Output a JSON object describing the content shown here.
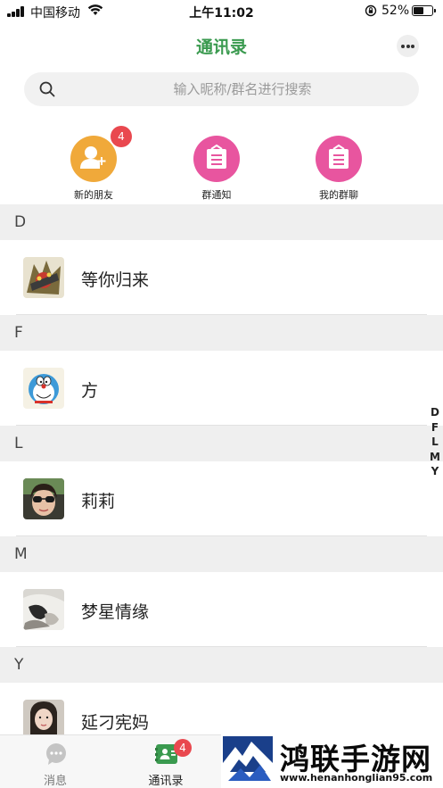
{
  "status_bar": {
    "carrier": "中国移动",
    "time": "上午11:02",
    "battery_percent": "52%",
    "battery_level": 0.52
  },
  "header": {
    "title": "通讯录",
    "more_icon": "more-dots-icon"
  },
  "search": {
    "placeholder": "输入昵称/群名进行搜索",
    "icon": "search-icon"
  },
  "quick_actions": [
    {
      "label": "新的朋友",
      "icon": "add-friend-icon",
      "color": "#f0a93a",
      "badge": "4"
    },
    {
      "label": "群通知",
      "icon": "notice-board-icon",
      "color": "#e8559f"
    },
    {
      "label": "我的群聊",
      "icon": "notice-board-icon",
      "color": "#e8559f"
    }
  ],
  "sections": [
    {
      "letter": "D",
      "contacts": [
        {
          "name": "等你归来"
        }
      ]
    },
    {
      "letter": "F",
      "contacts": [
        {
          "name": "方"
        }
      ]
    },
    {
      "letter": "L",
      "contacts": [
        {
          "name": "莉莉"
        }
      ]
    },
    {
      "letter": "M",
      "contacts": [
        {
          "name": "梦星情缘"
        }
      ]
    },
    {
      "letter": "Y",
      "contacts": [
        {
          "name": "延刁宪妈"
        }
      ]
    }
  ],
  "index_bar": [
    "D",
    "F",
    "L",
    "M",
    "Y"
  ],
  "tab_bar": {
    "tabs": [
      {
        "label": "消息",
        "icon": "chat-bubble-icon",
        "active": false
      },
      {
        "label": "通讯录",
        "icon": "contacts-book-icon",
        "active": true,
        "badge": "4"
      }
    ]
  },
  "watermark": {
    "title": "鸿联手游网",
    "url": "www.henanhonglian95.com"
  },
  "colors": {
    "accent_green": "#3a9a4f",
    "badge_red": "#e9484f",
    "section_bg": "#efefef"
  }
}
